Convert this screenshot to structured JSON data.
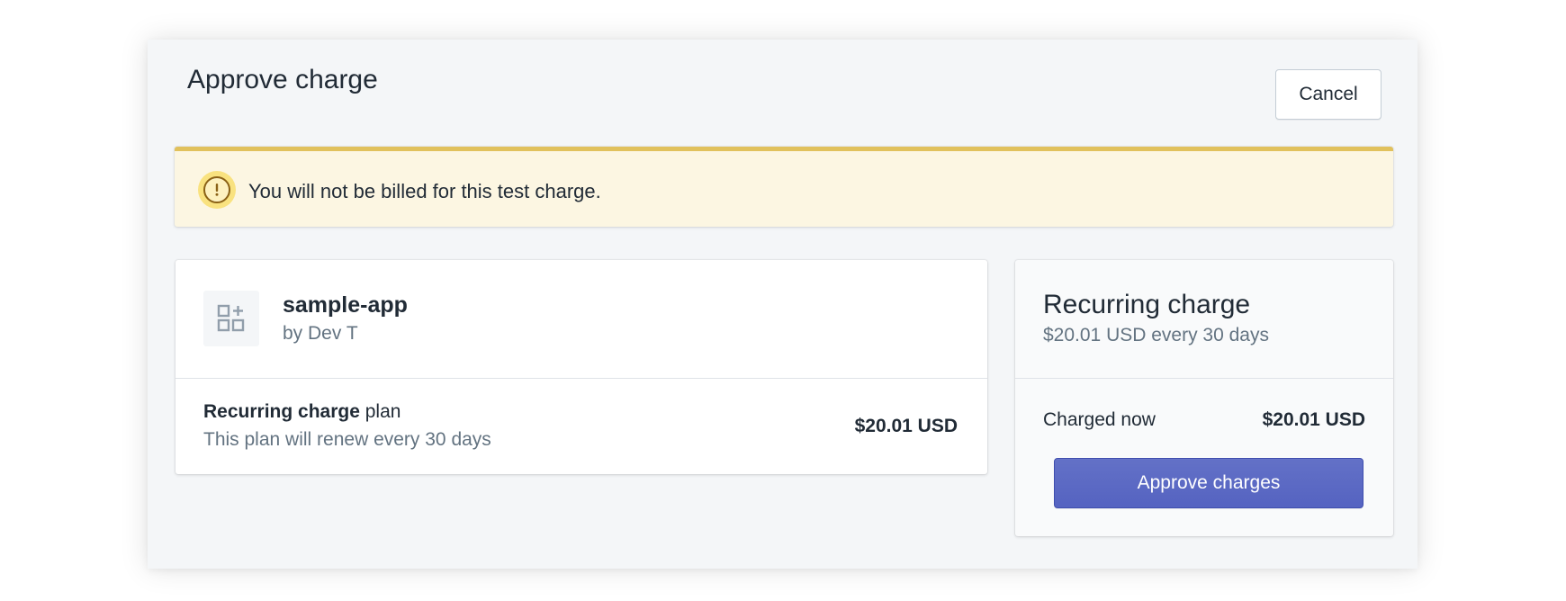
{
  "modal": {
    "title": "Approve charge",
    "cancel_label": "Cancel"
  },
  "banner": {
    "message": "You will not be billed for this test charge.",
    "icon": "exclamation-circle-icon",
    "color": "#e1c15c"
  },
  "app": {
    "name": "sample-app",
    "developer": "by Dev T",
    "icon": "apps-icon"
  },
  "plan": {
    "name_bold": "Recurring charge",
    "name_suffix": " plan",
    "description": "This plan will renew every 30 days",
    "price": "$20.01 USD"
  },
  "summary": {
    "title": "Recurring charge",
    "subtitle": "$20.01 USD every 30 days",
    "charged_label": "Charged now",
    "charged_value": "$20.01 USD",
    "approve_label": "Approve charges",
    "accent": "#5c6ac4"
  }
}
